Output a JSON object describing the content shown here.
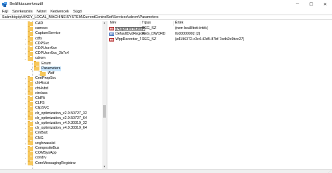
{
  "window": {
    "title": "Beállításszerkesztő",
    "minimize_glyph": "─",
    "maximize_glyph": "☐",
    "close_glyph": "✕"
  },
  "menu": [
    "Fájl",
    "Szerkesztés",
    "Nézet",
    "Kedvencek",
    "Súgó"
  ],
  "address": "Számítógép\\HKEY_LOCAL_MACHINE\\SYSTEM\\CurrentControlSet\\Services\\cdrom\\Parameters",
  "tree": {
    "items": [
      {
        "label": "CAD",
        "expander": ""
      },
      {
        "label": "camsvc",
        "expander": ""
      },
      {
        "label": "CaptureService",
        "expander": ""
      },
      {
        "label": "cdfs",
        "expander": "›"
      },
      {
        "label": "CDPSvc",
        "expander": "›"
      },
      {
        "label": "CDPUserSvc",
        "expander": "›"
      },
      {
        "label": "CDPUserSvc_2b7c4",
        "expander": "›"
      },
      {
        "label": "cdrom",
        "expander": "⌄"
      },
      {
        "label": "Enum",
        "expander": ""
      },
      {
        "label": "Parameters",
        "expander": "⌄"
      },
      {
        "label": "Wdf",
        "expander": ""
      },
      {
        "label": "CertPropSvc",
        "expander": "›"
      },
      {
        "label": "cht4iscsi",
        "expander": "›"
      },
      {
        "label": "cht4vbd",
        "expander": "›"
      },
      {
        "label": "circlass",
        "expander": "›"
      },
      {
        "label": "CldFlt",
        "expander": "›"
      },
      {
        "label": "CLFS",
        "expander": "›"
      },
      {
        "label": "ClipSVC",
        "expander": "›"
      },
      {
        "label": "clr_optimization_v2.0.50727_32",
        "expander": "›"
      },
      {
        "label": "clr_optimization_v2.0.50727_64",
        "expander": "›"
      },
      {
        "label": "clr_optimization_v4.0.30319_32",
        "expander": "›"
      },
      {
        "label": "clr_optimization_v4.0.30319_64",
        "expander": "›"
      },
      {
        "label": "CmBatt",
        "expander": "›"
      },
      {
        "label": "CNG",
        "expander": "›"
      },
      {
        "label": "cnghwassist",
        "expander": "›"
      },
      {
        "label": "CompositeBus",
        "expander": "›"
      },
      {
        "label": "COMSysApp",
        "expander": "›"
      },
      {
        "label": "condrv",
        "expander": "›"
      },
      {
        "label": "CoreMessagingRegistrar",
        "expander": "›"
      }
    ],
    "scroll_up_glyph": "▲",
    "scroll_down_glyph": "▼"
  },
  "list": {
    "columns": {
      "name": "Név",
      "type": "Típus",
      "data": "Érték"
    },
    "rows": [
      {
        "icon": "string-value-icon",
        "icon_text": "ab",
        "name": "(Alapértelmezett)",
        "type": "REG_SZ",
        "data": "(nem beállított érték)"
      },
      {
        "icon": "dword-value-icon",
        "icon_text": "01",
        "name": "DefaultDvdRegion",
        "type": "REG_DWORD",
        "data": "0x00000002 (2)"
      },
      {
        "icon": "string-value-icon",
        "icon_text": "ab",
        "name": "WppRecorder_Tr...",
        "type": "REG_SZ",
        "data": "{a4196372-c3c4-42d5-87bf-7edb2e9bcc27}"
      }
    ]
  },
  "colors": {
    "folder": "#f7c85c",
    "selection": "#cce8ff",
    "string_icon": "#b22222",
    "dword_icon": "#1e50a0"
  },
  "status": {
    "grip_glyph": "⋰"
  }
}
